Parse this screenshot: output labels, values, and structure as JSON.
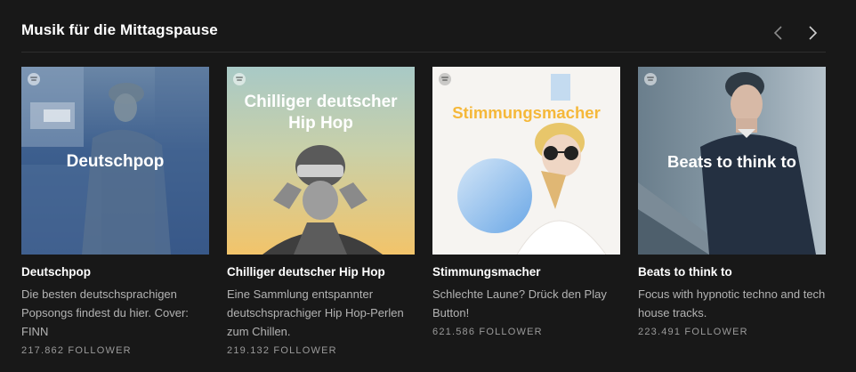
{
  "section": {
    "title": "Musik für die Mittagspause"
  },
  "nav": {
    "prev_icon": "chevron-left-icon",
    "next_icon": "chevron-right-icon"
  },
  "cards": [
    {
      "cover_text": "Deutschpop",
      "cover_color": "#3a5a8a",
      "title": "Deutschpop",
      "description": "Die besten deutschsprachigen Popsongs findest du hier. Cover: FINN",
      "followers": "217.862 FOLLOWER"
    },
    {
      "cover_text": "Chilliger deutscher Hip Hop",
      "cover_color": "#f2c36b",
      "title": "Chilliger deutscher Hip Hop",
      "description": "Eine Sammlung entspannter deutschsprachiger Hip Hop-Perlen zum Chillen.",
      "followers": "219.132 FOLLOWER"
    },
    {
      "cover_text": "Stimmungsmacher",
      "cover_color": "#f5f3f0",
      "title": "Stimmungsmacher",
      "description": "Schlechte Laune? Drück den Play Button!",
      "followers": "621.586 FOLLOWER"
    },
    {
      "cover_text": "Beats to think to",
      "cover_color": "#2d3d4e",
      "title": "Beats to think to",
      "description": "Focus with hypnotic techno and tech house tracks.",
      "followers": "223.491 FOLLOWER"
    }
  ]
}
